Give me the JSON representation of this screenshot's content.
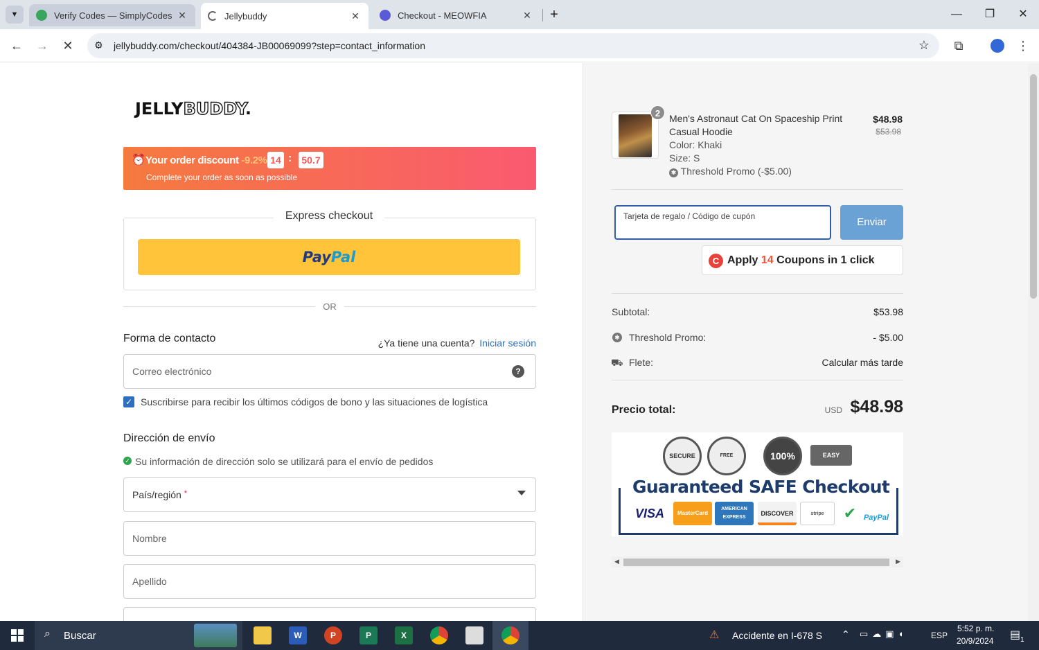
{
  "tabs": [
    {
      "title": "Verify Codes — SimplyCodes"
    },
    {
      "title": "Jellybuddy"
    },
    {
      "title": "Checkout - MEOWFIA"
    }
  ],
  "browser": {
    "url": "jellybuddy.com/checkout/404384-JB00069099?step=contact_information"
  },
  "store": {
    "logo_solid": "JELLY",
    "logo_hollow": "BUDDY",
    "logo_dot": "."
  },
  "discount_banner": {
    "title": "Your order discount",
    "percent": "-9.2%",
    "minutes": "14",
    "separator": ":",
    "seconds": "50.7",
    "subtitle": "Complete your order as soon as possible"
  },
  "express": {
    "title": "Express checkout",
    "paypal_part1": "Pay",
    "paypal_part2": "Pal",
    "or": "OR"
  },
  "contact": {
    "title": "Forma de contacto",
    "account_question": "¿Ya tiene una cuenta?",
    "login_link": "Iniciar sesión",
    "email_placeholder": "Correo electrónico",
    "subscribe_label": "Suscribirse para recibir los últimos códigos de bono y las situaciones de logística",
    "subscribe_checked": true
  },
  "shipping": {
    "title": "Dirección de envío",
    "note": "Su información de dirección solo se utilizará para el envío de pedidos",
    "country_label": "País/región",
    "required_mark": "*",
    "first_name": "Nombre",
    "last_name": "Apellido"
  },
  "cart": {
    "item": {
      "quantity": "2",
      "name_line1": "Men's Astronaut Cat On Spaceship Print",
      "name_line2": "Casual Hoodie",
      "color": "Color: Khaki",
      "size": "Size: S",
      "promo": "Threshold Promo (-$5.00)",
      "price": "$48.98",
      "original_price": "$53.98"
    },
    "coupon_placeholder": "Tarjeta de regalo / Código de cupón",
    "coupon_button": "Enviar",
    "apply_prefix": "Apply",
    "apply_count": "14",
    "apply_suffix": "Coupons in 1 click",
    "summary": {
      "subtotal_label": "Subtotal:",
      "subtotal_value": "$53.98",
      "promo_label": "Threshold Promo:",
      "promo_value": "- $5.00",
      "shipping_label": "Flete:",
      "shipping_value": "Calcular más tarde",
      "total_label": "Precio total:",
      "currency": "USD",
      "total_value": "$48.98"
    },
    "trust_badge": {
      "headline": "Guaranteed SAFE Checkout",
      "seal1": "SECURE",
      "seal2": "FREE SHIPPING",
      "seal3": "100%",
      "seal4": "EASY",
      "cards": [
        "VISA",
        "MasterCard",
        "AMERICAN EXPRESS",
        "DISCOVER",
        "stripe",
        "",
        "PayPal"
      ]
    }
  },
  "taskbar": {
    "search": "Buscar",
    "news": "Accidente en I-678 S",
    "lang": "ESP",
    "time": "5:52 p. m.",
    "date": "20/9/2024",
    "notifications": "1"
  },
  "colors": {
    "accent_blue": "#2f5da8",
    "paypal_yellow": "#ffc439",
    "banner_start": "#f57a3e",
    "banner_end": "#fa5a70"
  }
}
